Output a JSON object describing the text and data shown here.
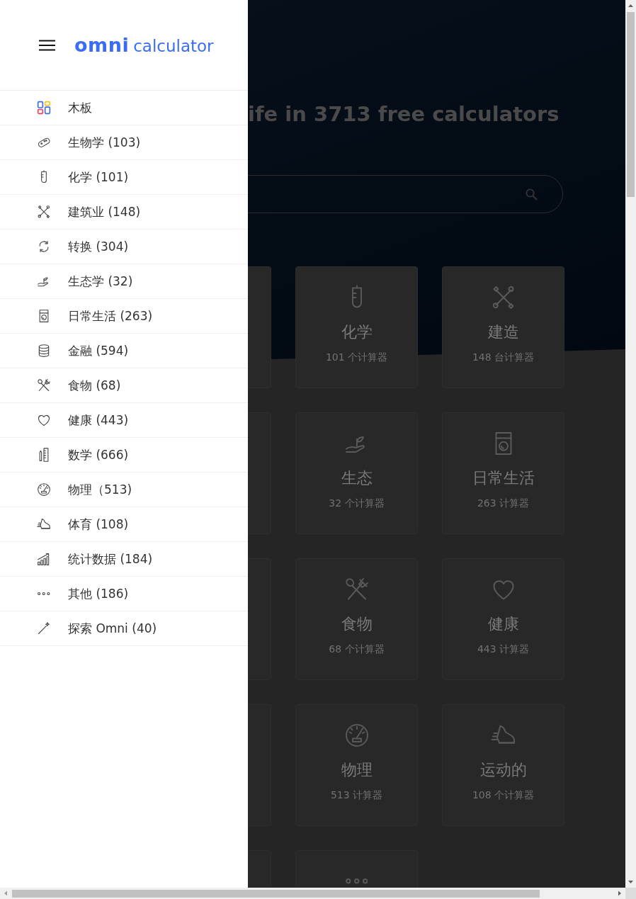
{
  "drawer": {
    "logo": {
      "brand": "omni",
      "product": "calculator"
    },
    "menu": [
      {
        "label": "木板"
      },
      {
        "label": "生物学 (103)"
      },
      {
        "label": "化学 (101)"
      },
      {
        "label": "建筑业 (148)"
      },
      {
        "label": "转换 (304)"
      },
      {
        "label": "生态学 (32)"
      },
      {
        "label": "日常生活 (263)"
      },
      {
        "label": "金融 (594)"
      },
      {
        "label": "食物 (68)"
      },
      {
        "label": "健康 (443)"
      },
      {
        "label": "数学 (666)"
      },
      {
        "label": "物理（513)"
      },
      {
        "label": "体育 (108)"
      },
      {
        "label": "统计数据 (184)"
      },
      {
        "label": "其他 (186)"
      },
      {
        "label": "探索 Omni (40)"
      }
    ]
  },
  "hero": {
    "heading": "ife in 3713 free calculators"
  },
  "cards": [
    {
      "kind": "sliver"
    },
    {
      "kind": "card",
      "title": "化学",
      "count": "101 个计算器"
    },
    {
      "kind": "card",
      "title": "建造",
      "count": "148 台计算器"
    },
    {
      "kind": "sliver"
    },
    {
      "kind": "card",
      "title": "生态",
      "count": "32 个计算器"
    },
    {
      "kind": "card",
      "title": "日常生活",
      "count": "263 计算器"
    },
    {
      "kind": "sliver"
    },
    {
      "kind": "card",
      "title": "食物",
      "count": "68 个计算器"
    },
    {
      "kind": "card",
      "title": "健康",
      "count": "443 计算器"
    },
    {
      "kind": "sliver"
    },
    {
      "kind": "card",
      "title": "物理",
      "count": "513 计算器"
    },
    {
      "kind": "card",
      "title": "运动的",
      "count": "108 个计算器"
    },
    {
      "kind": "sliver"
    },
    {
      "kind": "card"
    }
  ]
}
